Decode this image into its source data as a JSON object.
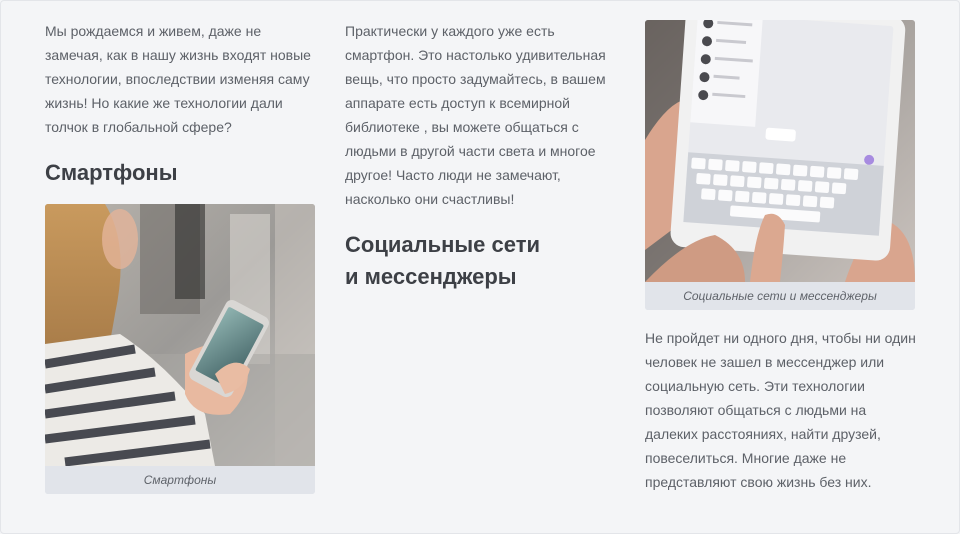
{
  "columns": {
    "left": {
      "intro": "Мы рождаемся и живем, даже не замечая, как в нашу жизнь входят новые технологии, впоследствии изменяя саму жизнь! Но какие же технологии дали толчок в глобальной сфере?",
      "heading": "Смартфоны",
      "image_caption": "Смартфоны"
    },
    "middle": {
      "text": "Практически у каждого уже есть смартфон. Это настолько удивительная вещь, что просто задумайтесь, в вашем аппарате есть доступ к всемирной библиотеке , вы можете общаться с людьми в другой части света и многое другое! Часто люди не замечают, насколько они счастливы!",
      "heading_line1": "Социальные сети",
      "heading_line2": "и мессенджеры"
    },
    "right": {
      "image_caption": "Социальные сети и мессенджеры",
      "text": "Не пройдет ни одного дня, чтобы ни один человек не зашел в мессенджер или социальную сеть. Эти технологии позволяют общаться с людьми на далеких расстояниях, найти друзей, повеселиться. Многие даже не представляют свою жизнь без них."
    }
  }
}
